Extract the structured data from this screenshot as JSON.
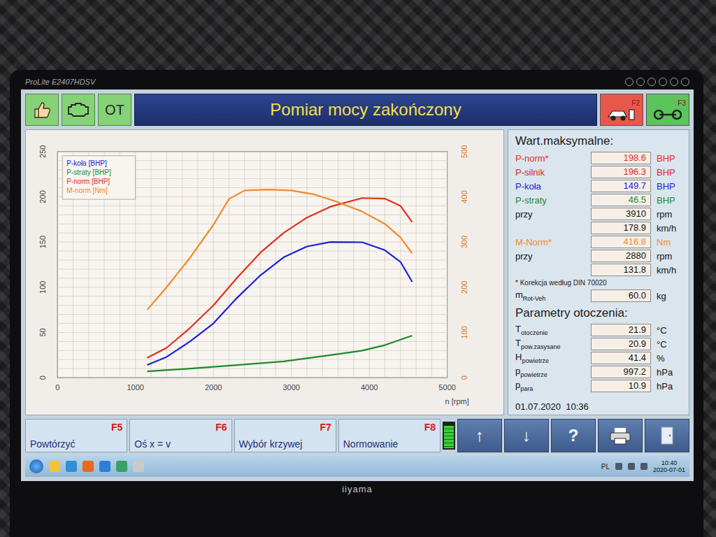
{
  "monitor": {
    "model": "ProLite E2407HDSV",
    "brand": "iiyama"
  },
  "toolbar": {
    "ot": "OT",
    "title": "Pomiar mocy zakończony",
    "keys": [
      {
        "key": "F2",
        "color": "#e8584a"
      },
      {
        "key": "F3",
        "color": "#5cc45c"
      }
    ]
  },
  "chart": {
    "x_ticks": [
      "0",
      "1000",
      "2000",
      "3000",
      "4000",
      "5000"
    ],
    "left_ticks": [
      "0",
      "50",
      "100",
      "150",
      "200",
      "250"
    ],
    "right_ticks": [
      "0",
      "100",
      "200",
      "300",
      "400",
      "500"
    ],
    "x_label": "n [rpm]",
    "series": [
      {
        "name": "P-koła [BHP]",
        "color": "#1a22d8",
        "axis": "left",
        "rpm": [
          1150,
          1400,
          1700,
          2000,
          2300,
          2600,
          2900,
          3200,
          3500,
          3910,
          4200,
          4400,
          4550
        ],
        "values": [
          14,
          23,
          40,
          60,
          88,
          113,
          133,
          145,
          150,
          149.7,
          141,
          128,
          106
        ]
      },
      {
        "name": "P-straty [BHP]",
        "color": "#1f8a2a",
        "axis": "left",
        "rpm": [
          1150,
          1700,
          2300,
          2900,
          3500,
          3910,
          4200,
          4550
        ],
        "values": [
          7,
          10,
          14,
          18,
          25,
          30,
          36,
          46.5
        ]
      },
      {
        "name": "P-norm [BHP]",
        "color": "#e0301e",
        "axis": "left",
        "rpm": [
          1150,
          1400,
          1700,
          2000,
          2300,
          2600,
          2900,
          3200,
          3500,
          3910,
          4200,
          4400,
          4550
        ],
        "values": [
          22,
          33,
          55,
          80,
          110,
          138,
          160,
          177,
          189,
          198.6,
          198,
          190,
          172
        ]
      },
      {
        "name": "M-norm [Nm]",
        "color": "#f08a2c",
        "axis": "right",
        "rpm": [
          1150,
          1400,
          1700,
          2000,
          2200,
          2400,
          2700,
          3000,
          3300,
          3600,
          3900,
          4200,
          4400,
          4550
        ],
        "values": [
          150,
          200,
          265,
          338,
          395,
          414,
          416,
          414,
          405,
          388,
          368,
          340,
          310,
          275
        ]
      }
    ]
  },
  "max_values": {
    "title": "Wart.maksymalne:",
    "rows": [
      {
        "label": "P-norm*",
        "value": "198.6",
        "unit": "BHP",
        "color": "#e0301e"
      },
      {
        "label": "P-silnik",
        "value": "196.3",
        "unit": "BHP",
        "color": "#d42a1c"
      },
      {
        "label": "P-koła",
        "value": "149.7",
        "unit": "BHP",
        "color": "#1a22d8"
      },
      {
        "label": "P-straty",
        "value": "46.5",
        "unit": "BHP",
        "color": "#1f8a2a"
      },
      {
        "label": "przy",
        "value": "3910",
        "unit": "rpm",
        "color": "#111111"
      },
      {
        "label": "",
        "value": "178.9",
        "unit": "km/h",
        "color": "#111111"
      },
      {
        "label": "M-Norm*",
        "value": "416.8",
        "unit": "Nm",
        "color": "#f08a2c"
      },
      {
        "label": "przy",
        "value": "2880",
        "unit": "rpm",
        "color": "#111111"
      },
      {
        "label": "",
        "value": "131.8",
        "unit": "km/h",
        "color": "#111111"
      }
    ],
    "note": "* Korekcja według DIN 70020",
    "mass": {
      "label": "m",
      "sub": "Rot-Veh",
      "value": "60.0",
      "unit": "kg"
    }
  },
  "ambient": {
    "title": "Parametry otoczenia:",
    "rows": [
      {
        "label": "T",
        "sub": "otoczenie",
        "value": "21.9",
        "unit": "°C"
      },
      {
        "label": "T",
        "sub": "pow.zasysane",
        "value": "20.9",
        "unit": "°C"
      },
      {
        "label": "H",
        "sub": "powietrze",
        "value": "41.4",
        "unit": "%"
      },
      {
        "label": "p",
        "sub": "powietrze",
        "value": "997.2",
        "unit": "hPa"
      },
      {
        "label": "p",
        "sub": "para",
        "value": "10.9",
        "unit": "hPa"
      }
    ]
  },
  "timestamp": "01.07.2020  10:36",
  "function_keys": [
    {
      "label": "Powtórzyć",
      "key": "F5"
    },
    {
      "label": "Oś x = v",
      "key": "F6"
    },
    {
      "label": "Wybór krzywej",
      "key": "F7"
    },
    {
      "label": "Normowanie",
      "key": "F8"
    }
  ],
  "meter": {
    "level": 0.9
  },
  "nav_buttons": [
    {
      "kind": "glyph",
      "symbol": "↑"
    },
    {
      "kind": "glyph",
      "symbol": "↓"
    },
    {
      "kind": "glyph",
      "symbol": "?"
    },
    {
      "kind": "printer"
    },
    {
      "kind": "exit"
    }
  ],
  "taskbar": {
    "language": "PL",
    "time": "10:40",
    "date": "2020-07-01"
  }
}
